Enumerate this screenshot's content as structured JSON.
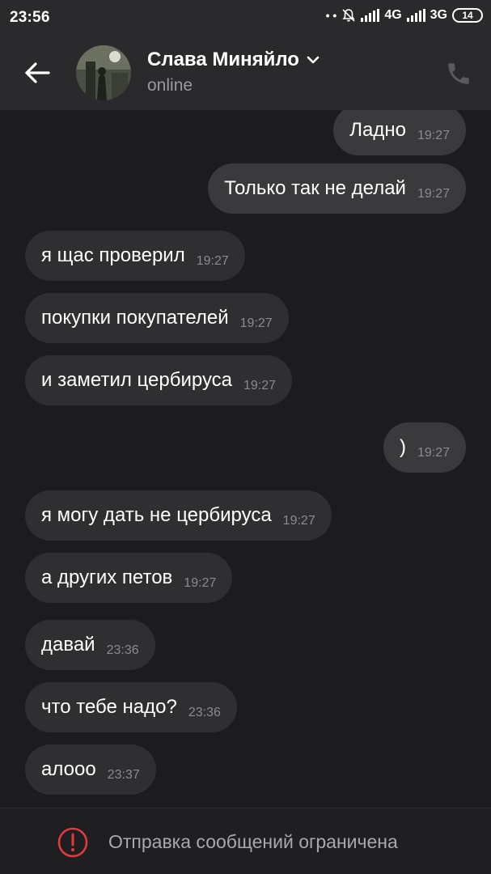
{
  "statusbar": {
    "time": "23:56",
    "net1": "4G",
    "net2": "3G",
    "battery": "14"
  },
  "header": {
    "contact_name": "Слава Миняйло",
    "status": "online"
  },
  "messages": [
    {
      "dir": "out",
      "text": "Ладно",
      "time": "19:27"
    },
    {
      "dir": "out",
      "text": "Только так не делай",
      "time": "19:27"
    },
    {
      "dir": "in",
      "text": "я щас проверил",
      "time": "19:27"
    },
    {
      "dir": "in",
      "text": "покупки покупателей",
      "time": "19:27"
    },
    {
      "dir": "in",
      "text": "и заметил цербируса",
      "time": "19:27"
    },
    {
      "dir": "out",
      "text": ")",
      "time": "19:27"
    },
    {
      "dir": "in",
      "text": "я могу дать не цербируса",
      "time": "19:27"
    },
    {
      "dir": "in",
      "text": "а других петов",
      "time": "19:27"
    },
    {
      "dir": "in",
      "text": "давай",
      "time": "23:36"
    },
    {
      "dir": "in",
      "text": "что тебе надо?",
      "time": "23:36"
    },
    {
      "dir": "in",
      "text": "алооо",
      "time": "23:37"
    }
  ],
  "footer": {
    "notice": "Отправка сообщений ограничена"
  },
  "colors": {
    "warning": "#e0393e",
    "bubble_out": "#3a3a3d",
    "bubble_in": "#2f2f32"
  }
}
